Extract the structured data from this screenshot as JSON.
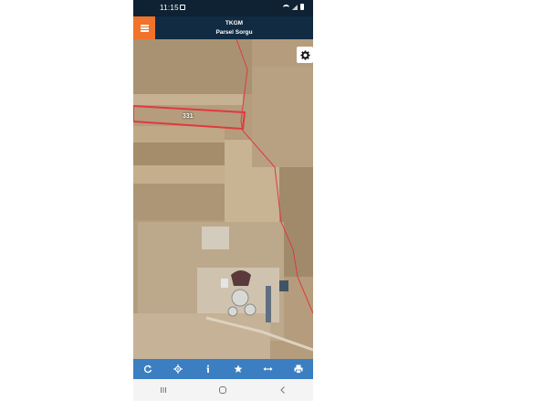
{
  "status_bar": {
    "time": "11:15",
    "icons": [
      "photo-icon",
      "wifi-icon",
      "signal-icon",
      "battery-icon"
    ]
  },
  "header": {
    "title": "TKGM",
    "subtitle": "Parsel Sorgu",
    "menu_icon": "hamburger-icon",
    "accent_color": "#f0722b",
    "background_color": "#102b42"
  },
  "map": {
    "parcel_label": "331",
    "settings_icon": "gear-icon",
    "parcel_border_color": "#e0393e"
  },
  "toolbar": {
    "background_color": "#3b7ec2",
    "buttons": [
      {
        "icon": "refresh-icon"
      },
      {
        "icon": "locate-icon"
      },
      {
        "icon": "info-icon"
      },
      {
        "icon": "star-icon"
      },
      {
        "icon": "measure-icon"
      },
      {
        "icon": "print-icon"
      }
    ]
  },
  "nav_bar": {
    "buttons": [
      {
        "icon": "recents-icon"
      },
      {
        "icon": "home-icon"
      },
      {
        "icon": "back-icon"
      }
    ]
  }
}
